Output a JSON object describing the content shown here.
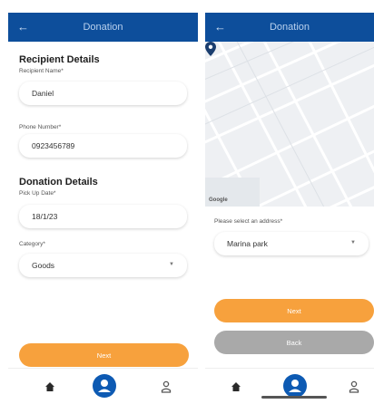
{
  "left_screen": {
    "appbar": {
      "title": "Donation",
      "back_icon": "arrow-left-icon"
    },
    "recipient_section": {
      "title": "Recipient Details",
      "name_label": "Recipient Name*",
      "name_value": "Daniel",
      "phone_label": "Phone Number*",
      "phone_value": "0923456789"
    },
    "donation_section": {
      "title": "Donation Details",
      "pickup_label": "Pick Up Date*",
      "pickup_value": "18/1/23",
      "category_label": "Category*",
      "category_value": "Goods"
    },
    "next_button": "Next",
    "nav": {
      "home_icon": "home-icon",
      "center_icon": "user-circle-icon",
      "profile_icon": "person-icon"
    }
  },
  "right_screen": {
    "appbar": {
      "title": "Donation",
      "back_icon": "arrow-left-icon"
    },
    "map": {
      "logo": "Google",
      "pin_icon": "map-pin-icon"
    },
    "address_label": "Please select an address*",
    "address_value": "Marina park",
    "next_button": "Next",
    "back_button": "Back",
    "nav": {
      "home_icon": "home-icon",
      "center_icon": "user-circle-icon",
      "profile_icon": "person-icon"
    }
  },
  "colors": {
    "appbar": "#0d4e9b",
    "accent_orange": "#f7a13d",
    "disabled_grey": "#a9a9a9",
    "nav_center": "#0d5ab3"
  }
}
